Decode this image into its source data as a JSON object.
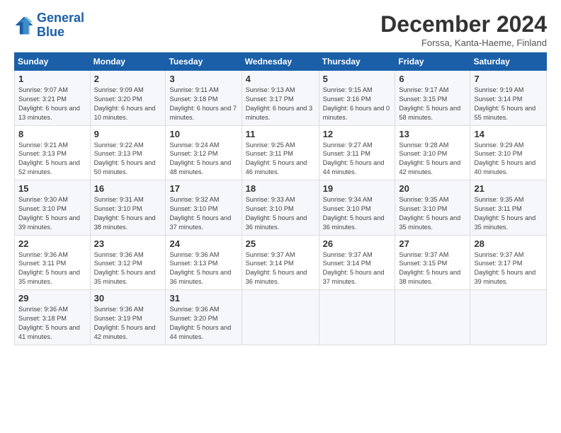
{
  "logo": {
    "line1": "General",
    "line2": "Blue"
  },
  "title": "December 2024",
  "subtitle": "Forssa, Kanta-Haeme, Finland",
  "weekdays": [
    "Sunday",
    "Monday",
    "Tuesday",
    "Wednesday",
    "Thursday",
    "Friday",
    "Saturday"
  ],
  "weeks": [
    [
      {
        "day": "1",
        "sunrise": "Sunrise: 9:07 AM",
        "sunset": "Sunset: 3:21 PM",
        "daylight": "Daylight: 6 hours and 13 minutes."
      },
      {
        "day": "2",
        "sunrise": "Sunrise: 9:09 AM",
        "sunset": "Sunset: 3:20 PM",
        "daylight": "Daylight: 6 hours and 10 minutes."
      },
      {
        "day": "3",
        "sunrise": "Sunrise: 9:11 AM",
        "sunset": "Sunset: 3:18 PM",
        "daylight": "Daylight: 6 hours and 7 minutes."
      },
      {
        "day": "4",
        "sunrise": "Sunrise: 9:13 AM",
        "sunset": "Sunset: 3:17 PM",
        "daylight": "Daylight: 6 hours and 3 minutes."
      },
      {
        "day": "5",
        "sunrise": "Sunrise: 9:15 AM",
        "sunset": "Sunset: 3:16 PM",
        "daylight": "Daylight: 6 hours and 0 minutes."
      },
      {
        "day": "6",
        "sunrise": "Sunrise: 9:17 AM",
        "sunset": "Sunset: 3:15 PM",
        "daylight": "Daylight: 5 hours and 58 minutes."
      },
      {
        "day": "7",
        "sunrise": "Sunrise: 9:19 AM",
        "sunset": "Sunset: 3:14 PM",
        "daylight": "Daylight: 5 hours and 55 minutes."
      }
    ],
    [
      {
        "day": "8",
        "sunrise": "Sunrise: 9:21 AM",
        "sunset": "Sunset: 3:13 PM",
        "daylight": "Daylight: 5 hours and 52 minutes."
      },
      {
        "day": "9",
        "sunrise": "Sunrise: 9:22 AM",
        "sunset": "Sunset: 3:13 PM",
        "daylight": "Daylight: 5 hours and 50 minutes."
      },
      {
        "day": "10",
        "sunrise": "Sunrise: 9:24 AM",
        "sunset": "Sunset: 3:12 PM",
        "daylight": "Daylight: 5 hours and 48 minutes."
      },
      {
        "day": "11",
        "sunrise": "Sunrise: 9:25 AM",
        "sunset": "Sunset: 3:11 PM",
        "daylight": "Daylight: 5 hours and 46 minutes."
      },
      {
        "day": "12",
        "sunrise": "Sunrise: 9:27 AM",
        "sunset": "Sunset: 3:11 PM",
        "daylight": "Daylight: 5 hours and 44 minutes."
      },
      {
        "day": "13",
        "sunrise": "Sunrise: 9:28 AM",
        "sunset": "Sunset: 3:10 PM",
        "daylight": "Daylight: 5 hours and 42 minutes."
      },
      {
        "day": "14",
        "sunrise": "Sunrise: 9:29 AM",
        "sunset": "Sunset: 3:10 PM",
        "daylight": "Daylight: 5 hours and 40 minutes."
      }
    ],
    [
      {
        "day": "15",
        "sunrise": "Sunrise: 9:30 AM",
        "sunset": "Sunset: 3:10 PM",
        "daylight": "Daylight: 5 hours and 39 minutes."
      },
      {
        "day": "16",
        "sunrise": "Sunrise: 9:31 AM",
        "sunset": "Sunset: 3:10 PM",
        "daylight": "Daylight: 5 hours and 38 minutes."
      },
      {
        "day": "17",
        "sunrise": "Sunrise: 9:32 AM",
        "sunset": "Sunset: 3:10 PM",
        "daylight": "Daylight: 5 hours and 37 minutes."
      },
      {
        "day": "18",
        "sunrise": "Sunrise: 9:33 AM",
        "sunset": "Sunset: 3:10 PM",
        "daylight": "Daylight: 5 hours and 36 minutes."
      },
      {
        "day": "19",
        "sunrise": "Sunrise: 9:34 AM",
        "sunset": "Sunset: 3:10 PM",
        "daylight": "Daylight: 5 hours and 36 minutes."
      },
      {
        "day": "20",
        "sunrise": "Sunrise: 9:35 AM",
        "sunset": "Sunset: 3:10 PM",
        "daylight": "Daylight: 5 hours and 35 minutes."
      },
      {
        "day": "21",
        "sunrise": "Sunrise: 9:35 AM",
        "sunset": "Sunset: 3:11 PM",
        "daylight": "Daylight: 5 hours and 35 minutes."
      }
    ],
    [
      {
        "day": "22",
        "sunrise": "Sunrise: 9:36 AM",
        "sunset": "Sunset: 3:11 PM",
        "daylight": "Daylight: 5 hours and 35 minutes."
      },
      {
        "day": "23",
        "sunrise": "Sunrise: 9:36 AM",
        "sunset": "Sunset: 3:12 PM",
        "daylight": "Daylight: 5 hours and 35 minutes."
      },
      {
        "day": "24",
        "sunrise": "Sunrise: 9:36 AM",
        "sunset": "Sunset: 3:13 PM",
        "daylight": "Daylight: 5 hours and 36 minutes."
      },
      {
        "day": "25",
        "sunrise": "Sunrise: 9:37 AM",
        "sunset": "Sunset: 3:14 PM",
        "daylight": "Daylight: 5 hours and 36 minutes."
      },
      {
        "day": "26",
        "sunrise": "Sunrise: 9:37 AM",
        "sunset": "Sunset: 3:14 PM",
        "daylight": "Daylight: 5 hours and 37 minutes."
      },
      {
        "day": "27",
        "sunrise": "Sunrise: 9:37 AM",
        "sunset": "Sunset: 3:15 PM",
        "daylight": "Daylight: 5 hours and 38 minutes."
      },
      {
        "day": "28",
        "sunrise": "Sunrise: 9:37 AM",
        "sunset": "Sunset: 3:17 PM",
        "daylight": "Daylight: 5 hours and 39 minutes."
      }
    ],
    [
      {
        "day": "29",
        "sunrise": "Sunrise: 9:36 AM",
        "sunset": "Sunset: 3:18 PM",
        "daylight": "Daylight: 5 hours and 41 minutes."
      },
      {
        "day": "30",
        "sunrise": "Sunrise: 9:36 AM",
        "sunset": "Sunset: 3:19 PM",
        "daylight": "Daylight: 5 hours and 42 minutes."
      },
      {
        "day": "31",
        "sunrise": "Sunrise: 9:36 AM",
        "sunset": "Sunset: 3:20 PM",
        "daylight": "Daylight: 5 hours and 44 minutes."
      },
      null,
      null,
      null,
      null
    ]
  ]
}
